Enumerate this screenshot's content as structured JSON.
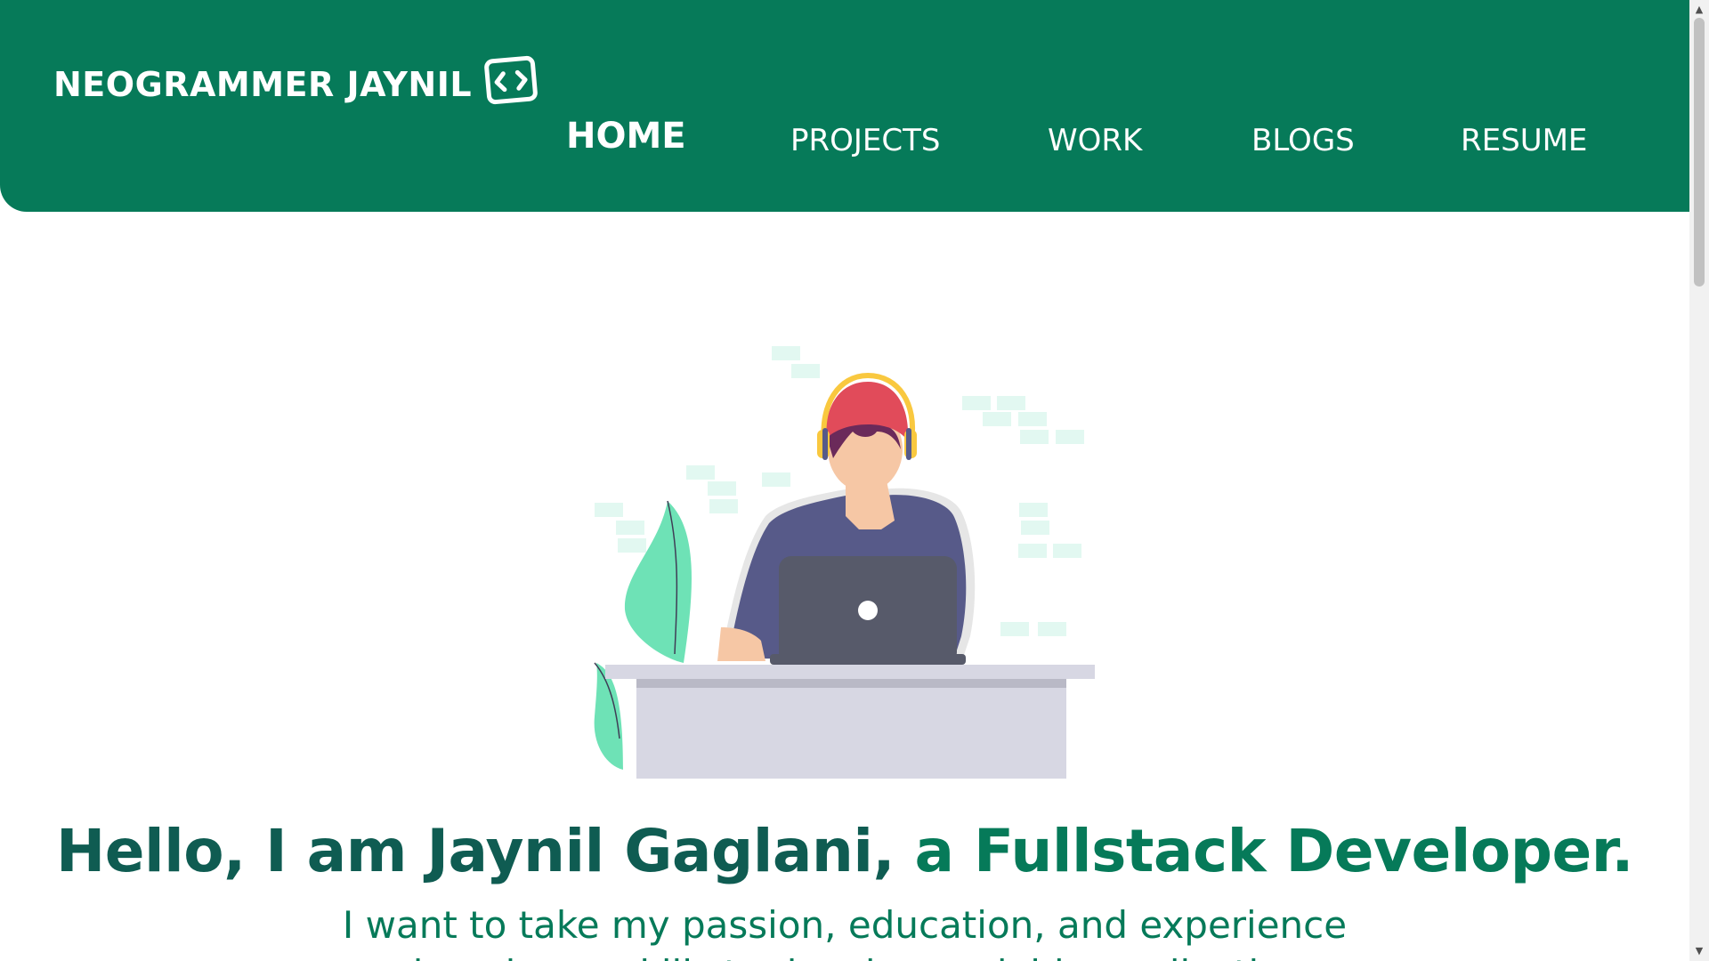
{
  "header": {
    "brand_name": "NEOGRAMMER JAYNIL",
    "brand_icon": "code-window-icon",
    "nav": [
      {
        "label": "HOME",
        "active": true
      },
      {
        "label": "PROJECTS",
        "active": false
      },
      {
        "label": "WORK",
        "active": false
      },
      {
        "label": "BLOGS",
        "active": false
      },
      {
        "label": "RESUME",
        "active": false
      }
    ]
  },
  "hero": {
    "illustration": "developer-with-laptop-illustration",
    "headline_intro": "Hello, I am Jaynil Gaglani,",
    "headline_role": "a Fullstack Developer.",
    "subline_1": "I want to take my passion, education, and experience",
    "subline_2": "and apply my skills to develop scalable applications."
  },
  "colors": {
    "brand_green": "#067a59",
    "headline_dark": "#0f5c52",
    "background": "#ffffff"
  }
}
